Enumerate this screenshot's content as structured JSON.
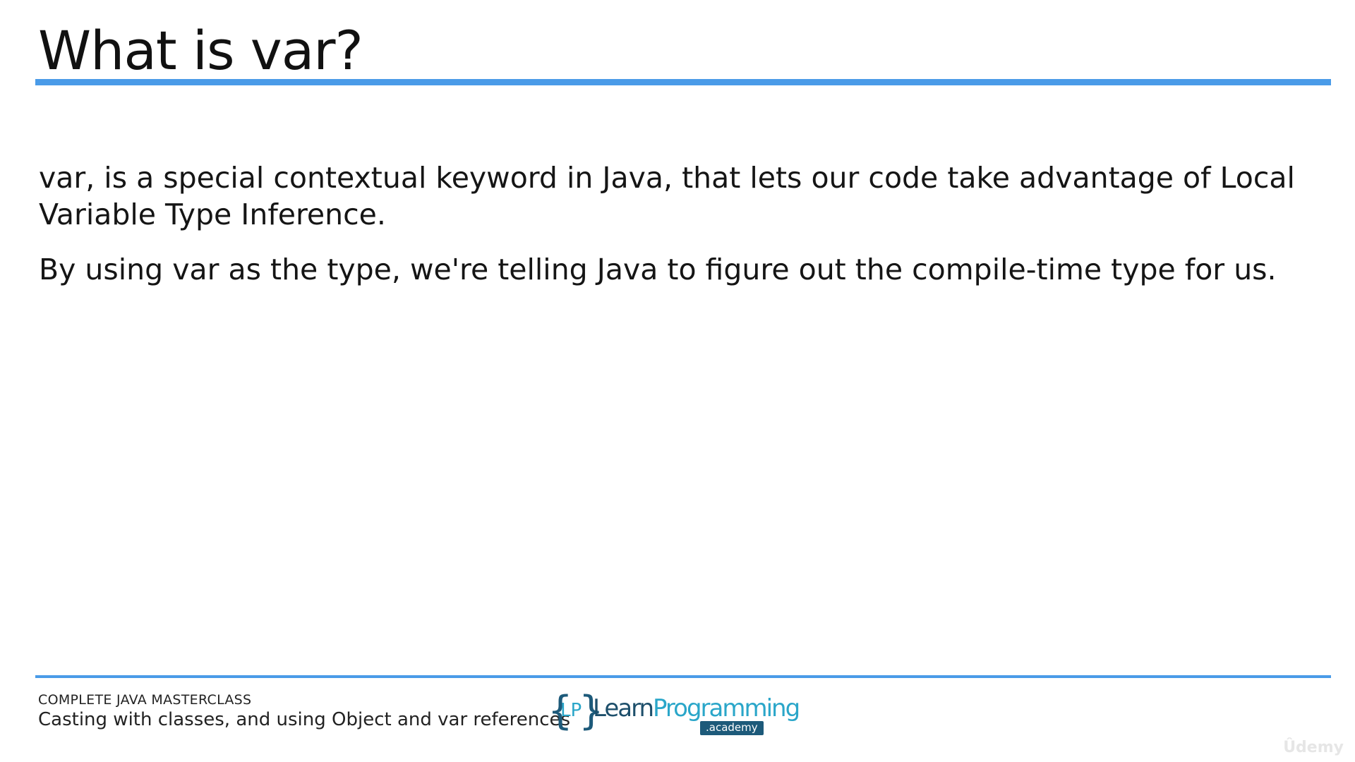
{
  "slide": {
    "title": "What is var?",
    "paragraphs": [
      "var, is a special contextual keyword in Java, that lets our code take advantage of Local Variable Type Inference.",
      "By using var as the type, we're telling Java to figure out the compile-time type for us."
    ]
  },
  "footer": {
    "course": "COMPLETE JAVA MASTERCLASS",
    "lecture": "Casting with classes, and using Object and var references"
  },
  "logo": {
    "brace_open": "{",
    "brace_close": "}",
    "initials": "LP",
    "name_part1": "Learn",
    "name_part2": "Programming",
    "tag": ".academy"
  },
  "watermark": "Ûdemy",
  "colors": {
    "accent_rule": "#4a9be8",
    "logo_dark": "#1d5a7a",
    "logo_light": "#2aa6c9"
  }
}
